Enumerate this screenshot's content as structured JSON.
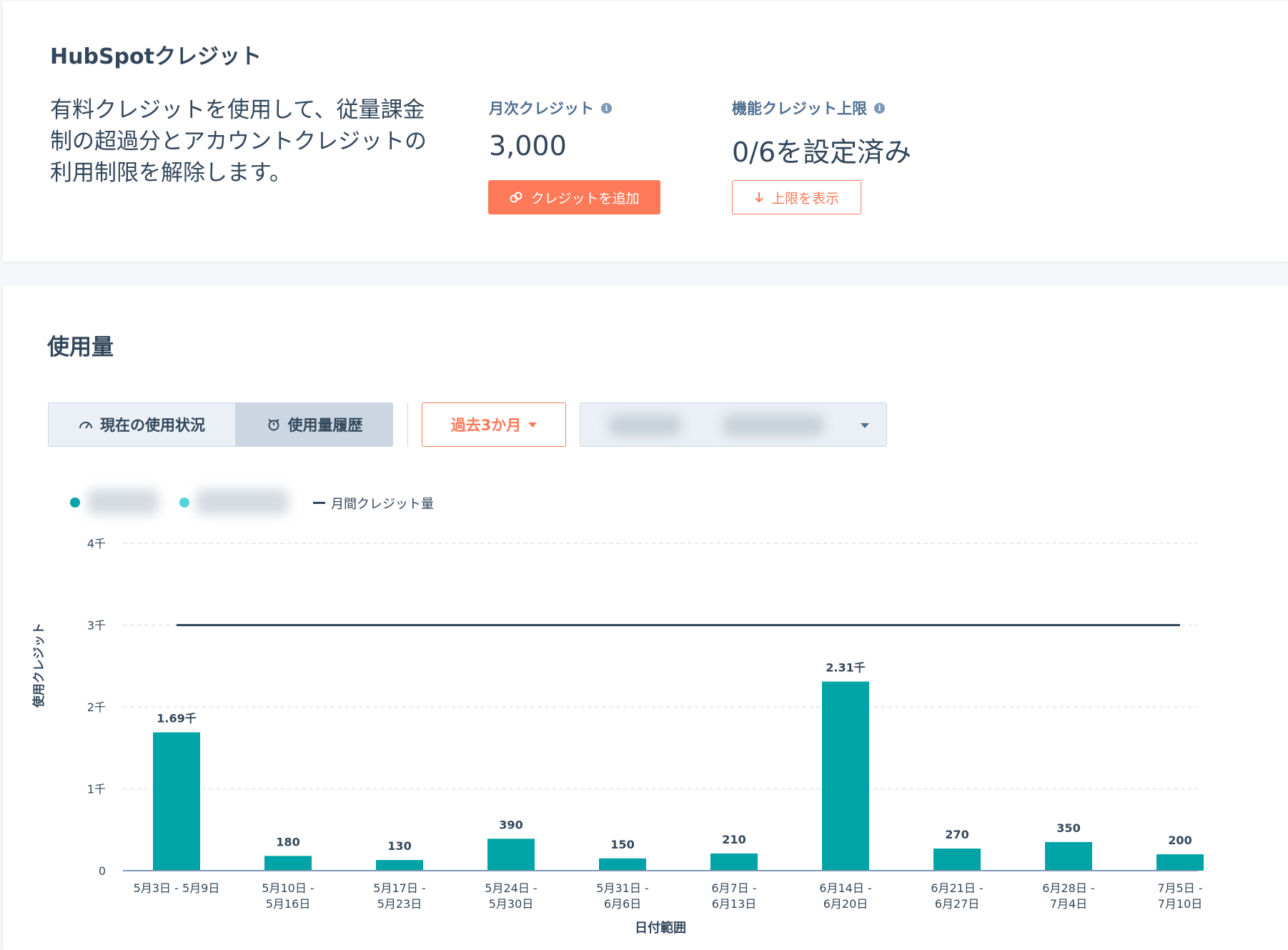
{
  "credits_card": {
    "title": "HubSpotクレジット",
    "description": "有料クレジットを使用して、従量課金制の超過分とアカウントクレジットの利用制限を解除します。",
    "monthly": {
      "label": "月次クレジット",
      "value": "3,000",
      "info_icon": "info-icon"
    },
    "limit": {
      "label": "機能クレジット上限",
      "value": "0/6を設定済み",
      "info_icon": "info-icon"
    },
    "add_button": {
      "label": "クレジットを追加",
      "icon": "link-icon"
    },
    "limits_button": {
      "label": "上限を表示",
      "icon": "arrow-down-icon"
    },
    "accent": "#ff7a59"
  },
  "usage_card": {
    "title": "使用量",
    "tabs": [
      {
        "label": "現在の使用状況",
        "icon": "gauge-icon",
        "selected": false
      },
      {
        "label": "使用量履歴",
        "icon": "history-icon",
        "selected": true
      }
    ],
    "range_dropdown": {
      "label": "過去3か月"
    },
    "filter_dropdown": {
      "value": ""
    },
    "legend": {
      "line_label": "月間クレジット量"
    }
  },
  "chart_data": {
    "type": "bar",
    "xlabel": "日付範囲",
    "ylabel": "使用クレジット",
    "ylim": [
      0,
      4000
    ],
    "yticks": [
      {
        "value": 0,
        "label": "0"
      },
      {
        "value": 1000,
        "label": "1千"
      },
      {
        "value": 2000,
        "label": "2千"
      },
      {
        "value": 3000,
        "label": "3千"
      },
      {
        "value": 4000,
        "label": "4千"
      }
    ],
    "categories": [
      [
        "5月3日 - 5月9日"
      ],
      [
        "5月10日 -",
        "5月16日"
      ],
      [
        "5月17日 -",
        "5月23日"
      ],
      [
        "5月24日 -",
        "5月30日"
      ],
      [
        "5月31日 -",
        "6月6日"
      ],
      [
        "6月7日 -",
        "6月13日"
      ],
      [
        "6月14日 -",
        "6月20日"
      ],
      [
        "6月21日 -",
        "6月27日"
      ],
      [
        "6月28日 -",
        "7月4日"
      ],
      [
        "7月5日 -",
        "7月10日"
      ]
    ],
    "values": [
      1690,
      180,
      130,
      390,
      150,
      210,
      2310,
      270,
      350,
      200
    ],
    "value_labels": [
      "1.69千",
      "180",
      "130",
      "390",
      "150",
      "210",
      "2.31千",
      "270",
      "350",
      "200"
    ],
    "reference_line": {
      "name": "月間クレジット量",
      "value": 3000
    },
    "grid": true,
    "colors": {
      "bar": "#00a4a6",
      "line": "#33475b",
      "grid": "#dfe3eb"
    }
  }
}
